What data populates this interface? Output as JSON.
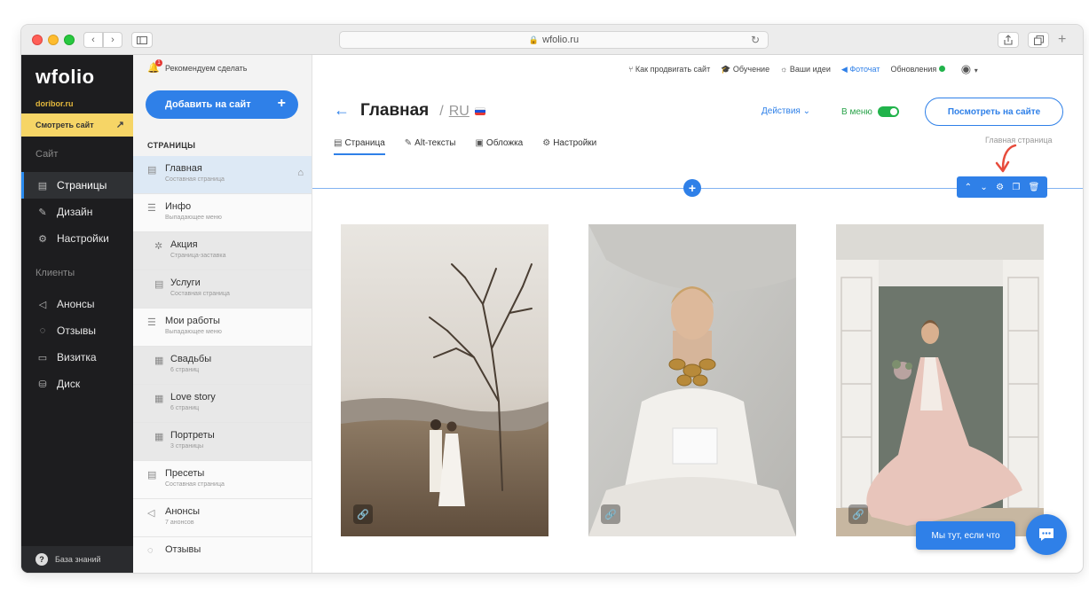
{
  "browser": {
    "address": "wfolio.ru",
    "back_glyph": "‹",
    "forward_glyph": "›"
  },
  "sidebar": {
    "logo": "wfolio",
    "site_domain": "doribor.ru",
    "view_site_label": "Смотреть сайт",
    "section_site": "Сайт",
    "section_clients": "Клиенты",
    "items": [
      {
        "label": "Страницы",
        "icon": "page-icon"
      },
      {
        "label": "Дизайн",
        "icon": "brush-icon"
      },
      {
        "label": "Настройки",
        "icon": "gear-icon"
      },
      {
        "label": "Анонсы",
        "icon": "megaphone-icon"
      },
      {
        "label": "Отзывы",
        "icon": "chat-icon"
      },
      {
        "label": "Визитка",
        "icon": "card-icon"
      },
      {
        "label": "Диск",
        "icon": "disk-icon"
      }
    ],
    "knowledge_base": "База знаний"
  },
  "pages_panel": {
    "recommend": "Рекомендуем сделать",
    "bell_count": "1",
    "add_button": "Добавить на сайт",
    "heading": "СТРАНИЦЫ",
    "items": [
      {
        "title": "Главная",
        "subtitle": "Составная страница"
      },
      {
        "title": "Инфо",
        "subtitle": "Выпадающее меню"
      },
      {
        "title": "Акция",
        "subtitle": "Страница-заставка"
      },
      {
        "title": "Услуги",
        "subtitle": "Составная страница"
      },
      {
        "title": "Мои работы",
        "subtitle": "Выпадающее меню"
      },
      {
        "title": "Свадьбы",
        "subtitle": "6 страниц"
      },
      {
        "title": "Love story",
        "subtitle": "6 страниц"
      },
      {
        "title": "Портреты",
        "subtitle": "3 страницы"
      },
      {
        "title": "Пресеты",
        "subtitle": "Составная страница"
      },
      {
        "title": "Анонсы",
        "subtitle": "7 анонсов"
      },
      {
        "title": "Отзывы",
        "subtitle": ""
      }
    ]
  },
  "topbar": {
    "promote": "Как продвигать сайт",
    "learning": "Обучение",
    "ideas": "Ваши идеи",
    "photochat": "Фоточат",
    "updates": "Обновления"
  },
  "main": {
    "title": "Главная",
    "lang": "RU",
    "actions": "Действия",
    "in_menu": "В меню",
    "view_on_site": "Посмотреть на сайте",
    "hint": "Главная страница",
    "tabs": [
      {
        "label": "Страница",
        "icon": "page-icon"
      },
      {
        "label": "Alt-тексты",
        "icon": "edit-icon"
      },
      {
        "label": "Обложка",
        "icon": "image-icon"
      },
      {
        "label": "Настройки",
        "icon": "gear-icon"
      }
    ]
  },
  "chat": {
    "bubble": "Мы тут, если что"
  },
  "colors": {
    "accent": "#2f80e8",
    "sidebar_bg": "#1d1d1f",
    "view_site_bg": "#f6d566",
    "toggle_on": "#21b34b"
  }
}
